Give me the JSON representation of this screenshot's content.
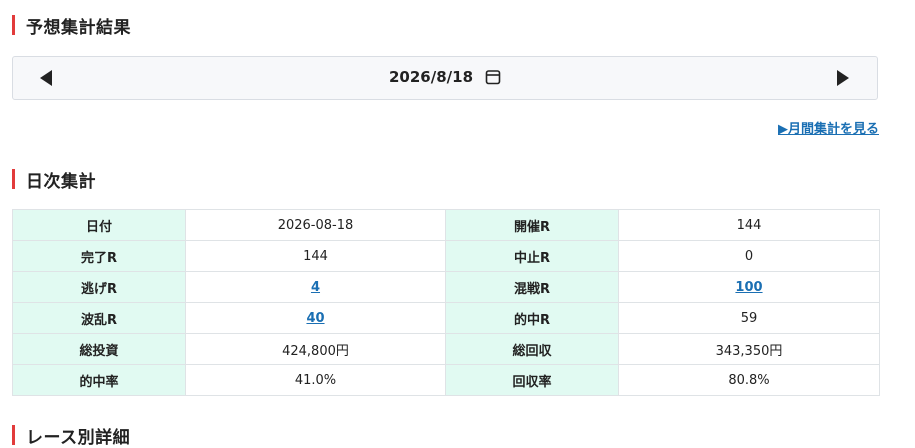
{
  "colors": {
    "accent_bar": "#e23b3b",
    "header_cell_bg": "#e1faf2",
    "link": "#1a6fb3"
  },
  "sections": {
    "forecast_title": "予想集計結果",
    "daily_title": "日次集計",
    "race_title": "レース別詳細"
  },
  "date_nav": {
    "date": "2026/8/18",
    "prev_icon": "caret-left-icon",
    "next_icon": "caret-right-icon",
    "calendar_icon": "calendar-icon"
  },
  "monthly_link": "▶月間集計を見る",
  "daily_table": {
    "rows": [
      {
        "l1": "日付",
        "v1": "2026-08-18",
        "l2": "開催R",
        "v2": "144"
      },
      {
        "l1": "完了R",
        "v1": "144",
        "l2": "中止R",
        "v2": "0"
      },
      {
        "l1": "逃げR",
        "v1": "4",
        "l2": "混戦R",
        "v2": "100"
      },
      {
        "l1": "波乱R",
        "v1": "40",
        "l2": "的中R",
        "v2": "59"
      },
      {
        "l1": "総投資",
        "v1": "424,800円",
        "l2": "総回収",
        "v2": "343,350円"
      },
      {
        "l1": "的中率",
        "v1": "41.0%",
        "l2": "回収率",
        "v2": "80.8%"
      }
    ]
  }
}
